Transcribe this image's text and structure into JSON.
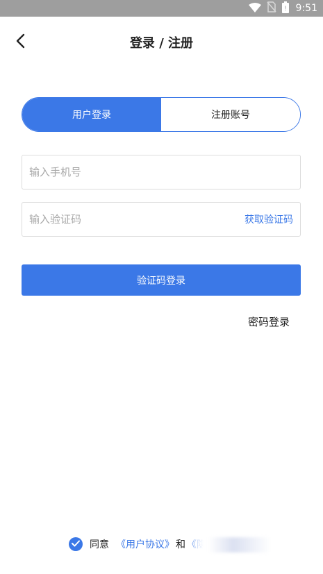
{
  "status_bar": {
    "time": "9:51",
    "icons": [
      "wifi-icon",
      "no-sim-icon",
      "battery-icon"
    ]
  },
  "header": {
    "title": "登录 / 注册"
  },
  "tabs": [
    {
      "label": "用户登录",
      "active": true
    },
    {
      "label": "注册账号",
      "active": false
    }
  ],
  "form": {
    "phone_placeholder": "输入手机号",
    "phone_value": "",
    "code_placeholder": "输入验证码",
    "code_value": "",
    "get_code_label": "获取验证码",
    "submit_label": "验证码登录",
    "password_login_label": "密码登录"
  },
  "agreement": {
    "checked": true,
    "agree_text": "同意",
    "user_agreement_label": "《用户协议》",
    "and_text": "和",
    "privacy_label": "《隐"
  },
  "colors": {
    "accent": "#3b78e7",
    "status_bar": "#9e9e9e",
    "placeholder": "#a8a8a8",
    "border": "#dcdcdc"
  }
}
